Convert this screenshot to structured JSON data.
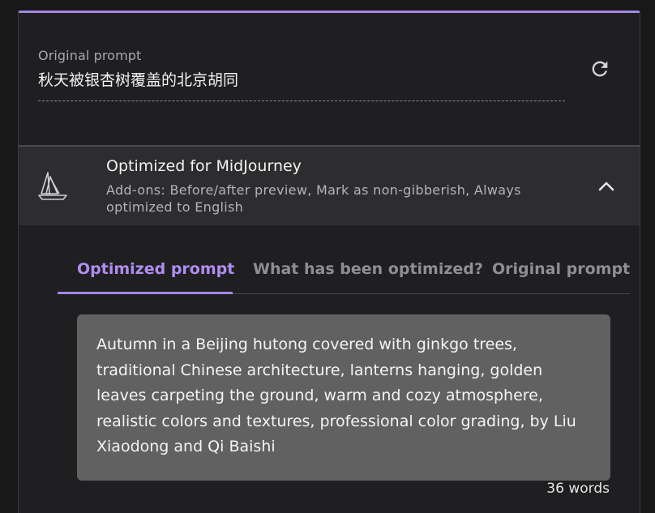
{
  "original": {
    "label": "Original prompt",
    "text": "秋天被银杏树覆盖的北京胡同",
    "refresh_icon": "refresh-icon"
  },
  "optimizer": {
    "icon": "sailboat-icon",
    "title": "Optimized for MidJourney",
    "addons": "Add-ons: Before/after preview, Mark as non-gibberish, Always optimized to English",
    "collapse_icon": "chevron-up-icon"
  },
  "tabs": [
    {
      "label": "Optimized prompt",
      "active": true
    },
    {
      "label": "What has been optimized?",
      "active": false
    },
    {
      "label": "Original prompt",
      "active": false
    }
  ],
  "result": {
    "text": "Autumn in a Beijing hutong covered with ginkgo trees, traditional Chinese architecture, lanterns hanging, golden leaves carpeting the ground, warm and cozy atmosphere, realistic colors and textures, professional color grading, by Liu Xiaodong and Qi Baishi",
    "word_count": "36",
    "word_count_unit": "words"
  },
  "colors": {
    "accent": "#a586e6",
    "background": "#1f1f21",
    "header": "#2d2d2f",
    "result_box": "#616161"
  }
}
